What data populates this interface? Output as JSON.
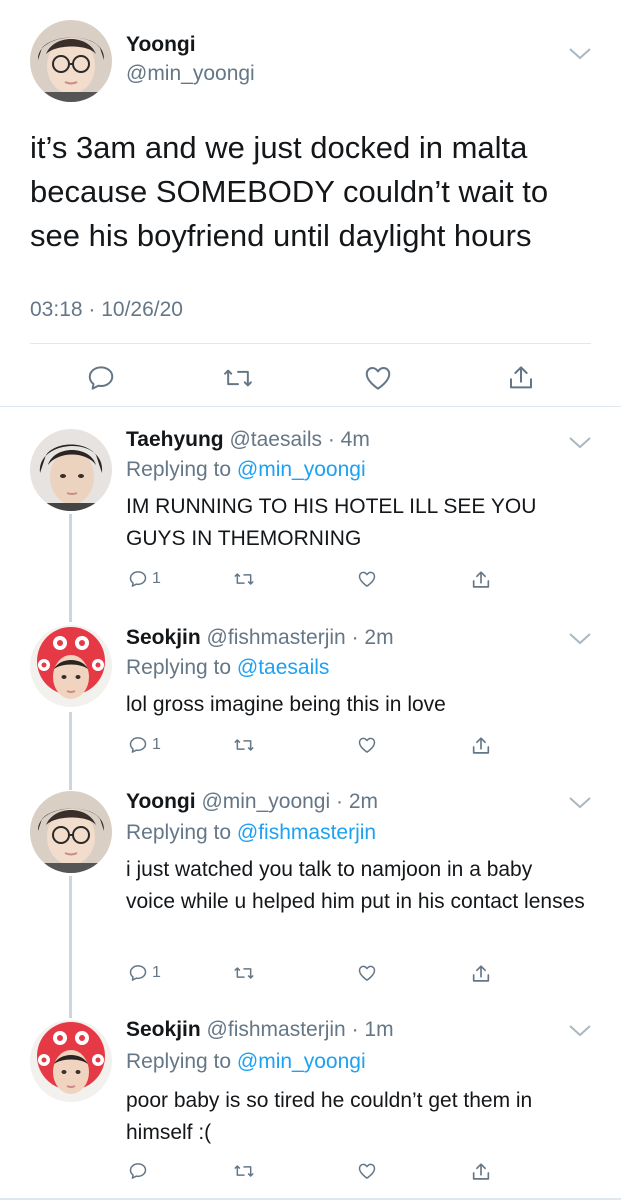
{
  "main_tweet": {
    "name": "Yoongi",
    "handle": "@min_yoongi",
    "text": "it’s 3am and we just docked in malta because SOMEBODY couldn’t wait to see his boyfriend until daylight hours",
    "timestamp": "03:18 · 10/26/20",
    "actions": [
      "reply-icon",
      "retweet-icon",
      "like-icon",
      "share-icon"
    ]
  },
  "replies": [
    {
      "name": "Taehyung",
      "handle": "@taesails",
      "time": "4m",
      "replying_prefix": "Replying to",
      "replying_to": "@min_yoongi",
      "text": "IM RUNNING TO HIS HOTEL ILL SEE YOU GUYS IN THEMORNING",
      "reply_count": "1"
    },
    {
      "name": "Seokjin",
      "handle": "@fishmasterjin",
      "time": "2m",
      "replying_prefix": "Replying to",
      "replying_to": "@taesails",
      "text": "lol gross imagine being this in love",
      "reply_count": "1"
    },
    {
      "name": "Yoongi",
      "handle": "@min_yoongi",
      "time": "2m",
      "replying_prefix": "Replying to",
      "replying_to": "@fishmasterjin",
      "text": "i just watched you talk to namjoon in a baby voice while u helped him put in his contact lenses",
      "reply_count": "1"
    },
    {
      "name": "Seokjin",
      "handle": "@fishmasterjin",
      "time": "1m",
      "replying_prefix": "Replying to",
      "replying_to": "@min_yoongi",
      "text": "poor baby is so tired he couldn’t get them in himself :(",
      "reply_count": ""
    }
  ],
  "colors": {
    "text": "#14171a",
    "secondary": "#657786",
    "link": "#1da1f2",
    "divider": "#e1e8ed",
    "thread_line": "#ccd6dd"
  }
}
